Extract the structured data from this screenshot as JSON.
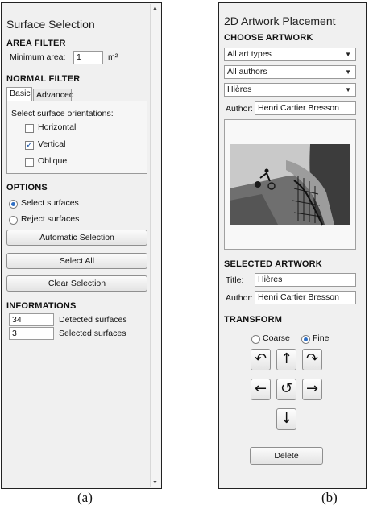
{
  "panel_a": {
    "title": "Surface Selection",
    "area_filter": {
      "heading": "AREA FILTER",
      "min_area_label": "Minimum area:",
      "min_area_value": "1",
      "unit": "m²"
    },
    "normal_filter": {
      "heading": "NORMAL FILTER",
      "tabs": [
        "Basic",
        "Advanced"
      ],
      "active_tab": "Basic",
      "prompt": "Select surface orientations:",
      "orientations": [
        {
          "label": "Horizontal",
          "checked": false
        },
        {
          "label": "Vertical",
          "checked": true
        },
        {
          "label": "Oblique",
          "checked": false
        }
      ]
    },
    "options": {
      "heading": "OPTIONS",
      "radios": [
        {
          "label": "Select surfaces",
          "selected": true
        },
        {
          "label": "Reject surfaces",
          "selected": false
        }
      ],
      "buttons": [
        "Automatic Selection",
        "Select All",
        "Clear Selection"
      ]
    },
    "informations": {
      "heading": "INFORMATIONS",
      "rows": [
        {
          "value": "34",
          "label": "Detected surfaces"
        },
        {
          "value": "3",
          "label": "Selected surfaces"
        }
      ]
    }
  },
  "panel_b": {
    "title": "2D Artwork Placement",
    "choose_artwork": {
      "heading": "CHOOSE ARTWORK",
      "art_type": "All art types",
      "authors": "All authors",
      "artwork": "Hières",
      "author_label": "Author:",
      "author_value": "Henri Cartier Bresson"
    },
    "selected_artwork": {
      "heading": "SELECTED ARTWORK",
      "title_label": "Title:",
      "title_value": "Hières",
      "author_label": "Author:",
      "author_value": "Henri Cartier Bresson"
    },
    "transform": {
      "heading": "TRANSFORM",
      "modes": [
        {
          "label": "Coarse",
          "selected": false
        },
        {
          "label": "Fine",
          "selected": true
        }
      ],
      "arrows": {
        "rotate_left": "↶",
        "up": "↑",
        "rotate_right": "↷",
        "left": "←",
        "reset": "↺",
        "right": "→",
        "down": "↓"
      },
      "delete_label": "Delete"
    }
  },
  "captions": {
    "a": "(a)",
    "b": "(b)"
  },
  "colors": {
    "panel_bg": "#f0f0f0",
    "accent": "#2f6fc4"
  }
}
